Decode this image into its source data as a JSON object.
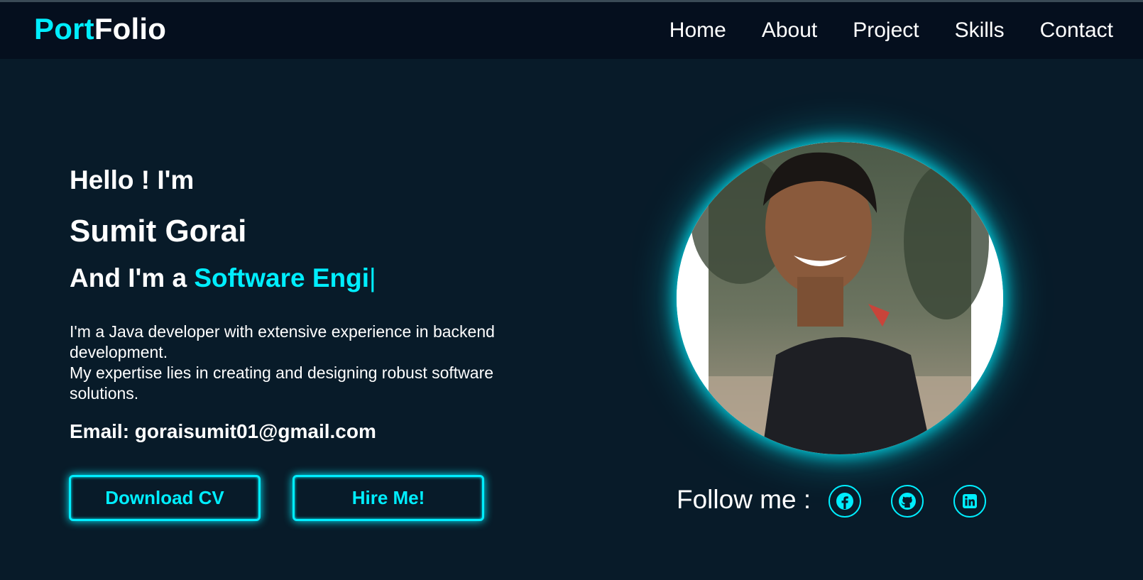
{
  "header": {
    "logo_part1": "Port",
    "logo_part2": "Folio",
    "nav": [
      "Home",
      "About",
      "Project",
      "Skills",
      "Contact"
    ]
  },
  "hero": {
    "greeting": "Hello ! I'm",
    "name": "Sumit Gorai",
    "role_prefix": "And I'm a",
    "role_typed": "Software Engi",
    "role_caret": "|",
    "bio_line1": "I'm a Java developer with extensive experience in backend development.",
    "bio_line2": "My expertise lies in creating and designing robust software solutions.",
    "email": "Email: goraisumit01@gmail.com",
    "download_cv": "Download CV",
    "hire_me": "Hire Me!"
  },
  "follow": {
    "label": "Follow me :",
    "icons": [
      "facebook-icon",
      "github-icon",
      "linkedin-icon"
    ]
  },
  "colors": {
    "background": "#081b29",
    "header": "#050f1e",
    "accent": "#00eeff",
    "text": "#ffffff"
  }
}
